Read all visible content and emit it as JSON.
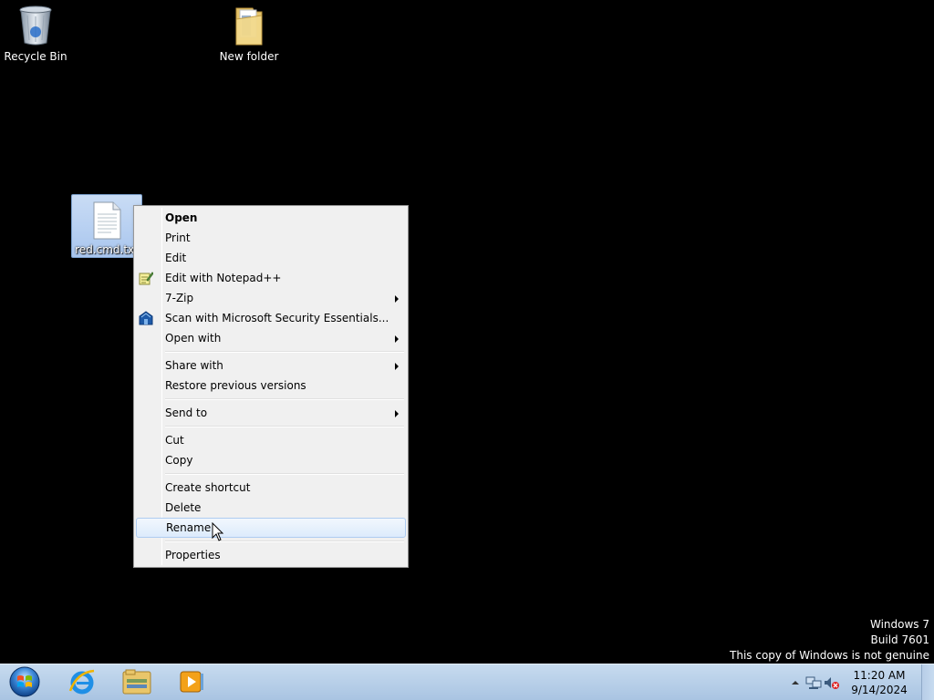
{
  "desktop": {
    "icons": [
      {
        "label": "Recycle Bin",
        "icon": "recycle-bin-icon"
      },
      {
        "label": "New folder",
        "icon": "folder-icon"
      },
      {
        "label": "red.cmd.txt",
        "icon": "text-file-icon"
      }
    ]
  },
  "context_menu": {
    "items": [
      {
        "label": "Open",
        "bold": true
      },
      {
        "label": "Print"
      },
      {
        "label": "Edit"
      },
      {
        "label": "Edit with Notepad++",
        "icon": "notepad-plus-plus-icon"
      },
      {
        "label": "7-Zip",
        "submenu": true
      },
      {
        "label": "Scan with Microsoft Security Essentials...",
        "icon": "security-essentials-icon"
      },
      {
        "label": "Open with",
        "submenu": true
      },
      {
        "label": "Share with",
        "submenu": true
      },
      {
        "label": "Restore previous versions"
      },
      {
        "label": "Send to",
        "submenu": true
      },
      {
        "label": "Cut"
      },
      {
        "label": "Copy"
      },
      {
        "label": "Create shortcut"
      },
      {
        "label": "Delete"
      },
      {
        "label": "Rename",
        "hovered": true
      },
      {
        "label": "Properties"
      }
    ]
  },
  "watermark": {
    "line1": "Windows 7",
    "line2": "Build 7601",
    "line3": "This copy of Windows is not genuine"
  },
  "taskbar": {
    "pinned": [
      "start-orb-icon",
      "internet-explorer-icon",
      "windows-explorer-icon",
      "windows-media-player-icon"
    ],
    "tray_icons": [
      "show-hidden-icons-arrow-icon",
      "network-icon",
      "volume-muted-icon"
    ],
    "clock": {
      "time": "11:20 AM",
      "date": "9/14/2024"
    }
  },
  "colors": {
    "desktop_bg": "#000000",
    "taskbar": "#b5cde8",
    "menu_bg": "#f0f0f0",
    "menu_hover": "#dcebfc",
    "selection": "#a9c6ee"
  }
}
